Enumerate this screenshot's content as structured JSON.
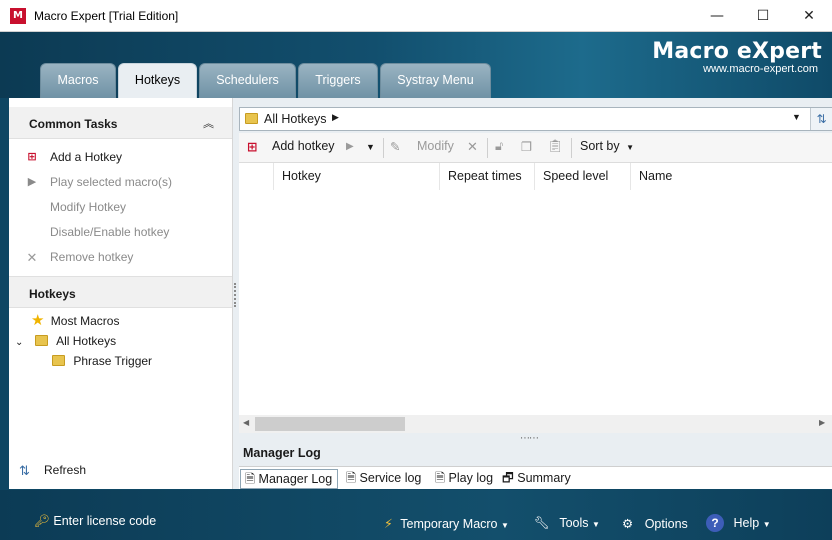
{
  "window": {
    "title": "Macro Expert [Trial Edition]",
    "app_icon_letter": "M",
    "controls": {
      "minimize": "—",
      "maximize": "☐",
      "close": "✕"
    }
  },
  "banner": {
    "brand": "Macro eXpert",
    "url": "www.macro-expert.com"
  },
  "tabs": [
    {
      "label": "Macros"
    },
    {
      "label": "Hotkeys"
    },
    {
      "label": "Schedulers"
    },
    {
      "label": "Triggers"
    },
    {
      "label": "Systray Menu"
    }
  ],
  "common_tasks": {
    "title": "Common Tasks",
    "items": [
      {
        "label": "Add a Hotkey"
      },
      {
        "label": "Play selected macro(s)"
      },
      {
        "label": "Modify Hotkey"
      },
      {
        "label": "Disable/Enable hotkey"
      },
      {
        "label": "Remove hotkey"
      }
    ]
  },
  "hotkeys_tree": {
    "title": "Hotkeys",
    "items": [
      {
        "label": "Most Macros"
      },
      {
        "label": "All Hotkeys"
      },
      {
        "label": "Phrase Trigger"
      }
    ]
  },
  "refresh_label": "Refresh",
  "pathbar": {
    "path": "All Hotkeys"
  },
  "toolbar": {
    "add": "Add hotkey",
    "modify": "Modify",
    "sort": "Sort by"
  },
  "grid": {
    "columns": [
      "Hotkey",
      "Repeat times",
      "Speed level",
      "Name"
    ]
  },
  "log": {
    "title": "Manager Log",
    "tabs": [
      {
        "label": "Manager Log"
      },
      {
        "label": "Service log"
      },
      {
        "label": "Play log"
      },
      {
        "label": "Summary"
      }
    ]
  },
  "statusbar": {
    "license": "Enter license code",
    "temporary_macro": "Temporary Macro",
    "tools": "Tools",
    "options": "Options",
    "help": "Help"
  },
  "colors": {
    "banner_bg": "#0e4663",
    "panel_bg": "#e9eef2",
    "accent_red": "#c8102e"
  }
}
